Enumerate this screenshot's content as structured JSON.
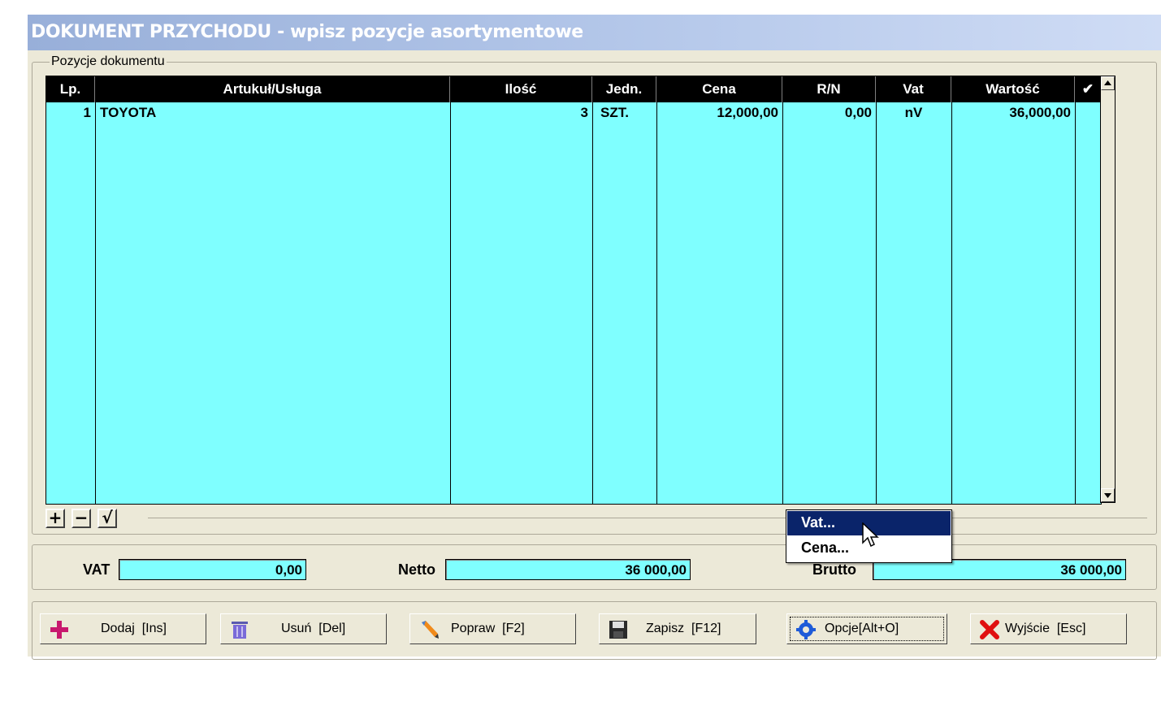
{
  "window": {
    "title": "DOKUMENT PRZYCHODU - wpisz pozycje asortymentowe"
  },
  "group": {
    "title": "Pozycje dokumentu"
  },
  "grid": {
    "columns": [
      "Lp.",
      "Artukuł/Usługa",
      "Ilość",
      "Jedn.",
      "Cena",
      "R/N",
      "Vat",
      "Wartość",
      "✔"
    ],
    "rows": [
      {
        "lp": "1",
        "artykul": "TOYOTA",
        "ilosc": "3",
        "jedn": "SZT.",
        "cena": "12,000,00",
        "rn": "0,00",
        "vat": "nV",
        "wartosc": "36,000,00"
      }
    ]
  },
  "nav": {
    "add": "+",
    "remove": "−",
    "check": "√"
  },
  "totals": {
    "vat_label": "VAT",
    "vat_value": "0,00",
    "netto_label": "Netto",
    "netto_value": "36 000,00",
    "brutto_label": "Brutto",
    "brutto_value": "36 000,00"
  },
  "popup_menu": {
    "items": [
      "Vat...",
      "Cena..."
    ],
    "selected_index": 0
  },
  "buttons": {
    "dodaj": "Dodaj  [Ins]",
    "usun": "Usuń  [Del]",
    "popraw": "Popraw  [F2]",
    "zapisz": "Zapisz  [F12]",
    "opcje": "Opcje[Alt+O]",
    "wyjscie": "Wyjście  [Esc]"
  },
  "colors": {
    "grid_bg": "#7fffff",
    "header_bg": "#000000",
    "menu_highlight": "#0a246a",
    "dialog_bg": "#ece9d8"
  },
  "icons": {
    "dodaj": "plus-icon",
    "usun": "trash-icon",
    "popraw": "pencil-icon",
    "zapisz": "floppy-icon",
    "opcje": "gear-icon",
    "wyjscie": "close-icon"
  }
}
